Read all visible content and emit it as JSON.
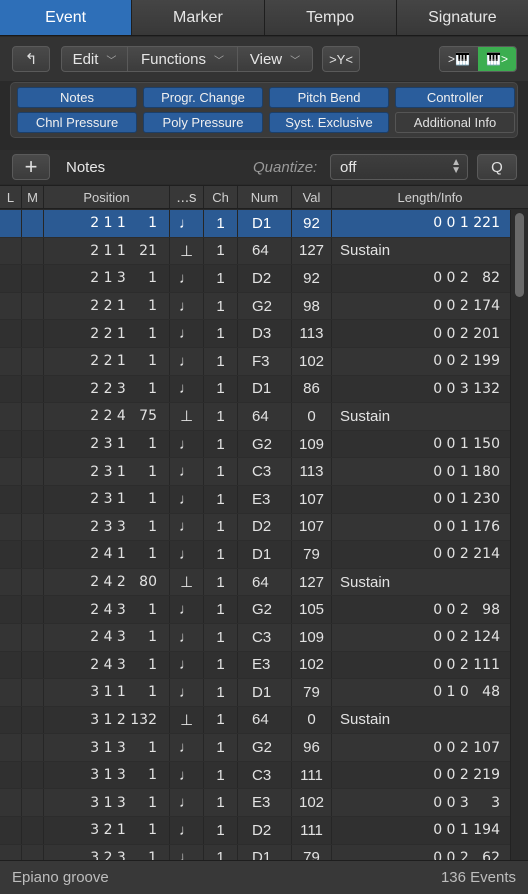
{
  "tabs": [
    {
      "label": "Event",
      "active": true
    },
    {
      "label": "Marker",
      "active": false
    },
    {
      "label": "Tempo",
      "active": false
    },
    {
      "label": "Signature",
      "active": false
    }
  ],
  "toolbar": {
    "back_icon": "↰",
    "edit_label": "Edit",
    "functions_label": "Functions",
    "view_label": "View",
    "chevron": "﹀",
    "filter_icon": ">Y<",
    "midi_in_label": ">🎹",
    "midi_out_label": "🎹>"
  },
  "filters": [
    {
      "label": "Notes",
      "on": true
    },
    {
      "label": "Progr. Change",
      "on": true
    },
    {
      "label": "Pitch Bend",
      "on": true
    },
    {
      "label": "Controller",
      "on": true
    },
    {
      "label": "Chnl Pressure",
      "on": true
    },
    {
      "label": "Poly Pressure",
      "on": true
    },
    {
      "label": "Syst. Exclusive",
      "on": true
    },
    {
      "label": "Additional Info",
      "on": false
    }
  ],
  "insert_bar": {
    "plus_label": "+",
    "type_label": "Notes",
    "quantize_label": "Quantize:",
    "quantize_value": "off",
    "q_label": "Q"
  },
  "columns": [
    "L",
    "M",
    "Position",
    "...s",
    "Ch",
    "Num",
    "Val",
    "Length/Info"
  ],
  "rows": [
    {
      "pos": "2 1 1     1",
      "st": "note",
      "ch": "1",
      "num": "D1",
      "val": "92",
      "len": "0 0 1 221",
      "selected": true
    },
    {
      "pos": "2 1 1   21",
      "st": "ctrl",
      "ch": "1",
      "num": "64",
      "val": "127",
      "len": "Sustain"
    },
    {
      "pos": "2 1 3     1",
      "st": "note",
      "ch": "1",
      "num": "D2",
      "val": "92",
      "len": "0 0 2   82"
    },
    {
      "pos": "2 2 1     1",
      "st": "note",
      "ch": "1",
      "num": "G2",
      "val": "98",
      "len": "0 0 2 174"
    },
    {
      "pos": "2 2 1     1",
      "st": "note",
      "ch": "1",
      "num": "D3",
      "val": "113",
      "len": "0 0 2 201"
    },
    {
      "pos": "2 2 1     1",
      "st": "note",
      "ch": "1",
      "num": "F3",
      "val": "102",
      "len": "0 0 2 199"
    },
    {
      "pos": "2 2 3     1",
      "st": "note",
      "ch": "1",
      "num": "D1",
      "val": "86",
      "len": "0 0 3 132"
    },
    {
      "pos": "2 2 4   75",
      "st": "ctrl",
      "ch": "1",
      "num": "64",
      "val": "0",
      "len": "Sustain"
    },
    {
      "pos": "2 3 1     1",
      "st": "note",
      "ch": "1",
      "num": "G2",
      "val": "109",
      "len": "0 0 1 150"
    },
    {
      "pos": "2 3 1     1",
      "st": "note",
      "ch": "1",
      "num": "C3",
      "val": "113",
      "len": "0 0 1 180"
    },
    {
      "pos": "2 3 1     1",
      "st": "note",
      "ch": "1",
      "num": "E3",
      "val": "107",
      "len": "0 0 1 230"
    },
    {
      "pos": "2 3 3     1",
      "st": "note",
      "ch": "1",
      "num": "D2",
      "val": "107",
      "len": "0 0 1 176"
    },
    {
      "pos": "2 4 1     1",
      "st": "note",
      "ch": "1",
      "num": "D1",
      "val": "79",
      "len": "0 0 2 214"
    },
    {
      "pos": "2 4 2   80",
      "st": "ctrl",
      "ch": "1",
      "num": "64",
      "val": "127",
      "len": "Sustain"
    },
    {
      "pos": "2 4 3     1",
      "st": "note",
      "ch": "1",
      "num": "G2",
      "val": "105",
      "len": "0 0 2   98"
    },
    {
      "pos": "2 4 3     1",
      "st": "note",
      "ch": "1",
      "num": "C3",
      "val": "109",
      "len": "0 0 2 124"
    },
    {
      "pos": "2 4 3     1",
      "st": "note",
      "ch": "1",
      "num": "E3",
      "val": "102",
      "len": "0 0 2 111"
    },
    {
      "pos": "3 1 1     1",
      "st": "note",
      "ch": "1",
      "num": "D1",
      "val": "79",
      "len": "0 1 0   48"
    },
    {
      "pos": "3 1 2 132",
      "st": "ctrl",
      "ch": "1",
      "num": "64",
      "val": "0",
      "len": "Sustain"
    },
    {
      "pos": "3 1 3     1",
      "st": "note",
      "ch": "1",
      "num": "G2",
      "val": "96",
      "len": "0 0 2 107"
    },
    {
      "pos": "3 1 3     1",
      "st": "note",
      "ch": "1",
      "num": "C3",
      "val": "111",
      "len": "0 0 2 219"
    },
    {
      "pos": "3 1 3     1",
      "st": "note",
      "ch": "1",
      "num": "E3",
      "val": "102",
      "len": "0 0 3     3"
    },
    {
      "pos": "3 2 1     1",
      "st": "note",
      "ch": "1",
      "num": "D2",
      "val": "111",
      "len": "0 0 1 194"
    },
    {
      "pos": "3 2 3     1",
      "st": "note",
      "ch": "1",
      "num": "D1",
      "val": "79",
      "len": "0 0 2   62"
    }
  ],
  "status": {
    "region_name": "Epiano groove",
    "event_count": "136 Events"
  },
  "colors": {
    "accent": "#2e6fb8",
    "selected_row": "#2b5a93",
    "midi_out_on": "#3cae50"
  }
}
